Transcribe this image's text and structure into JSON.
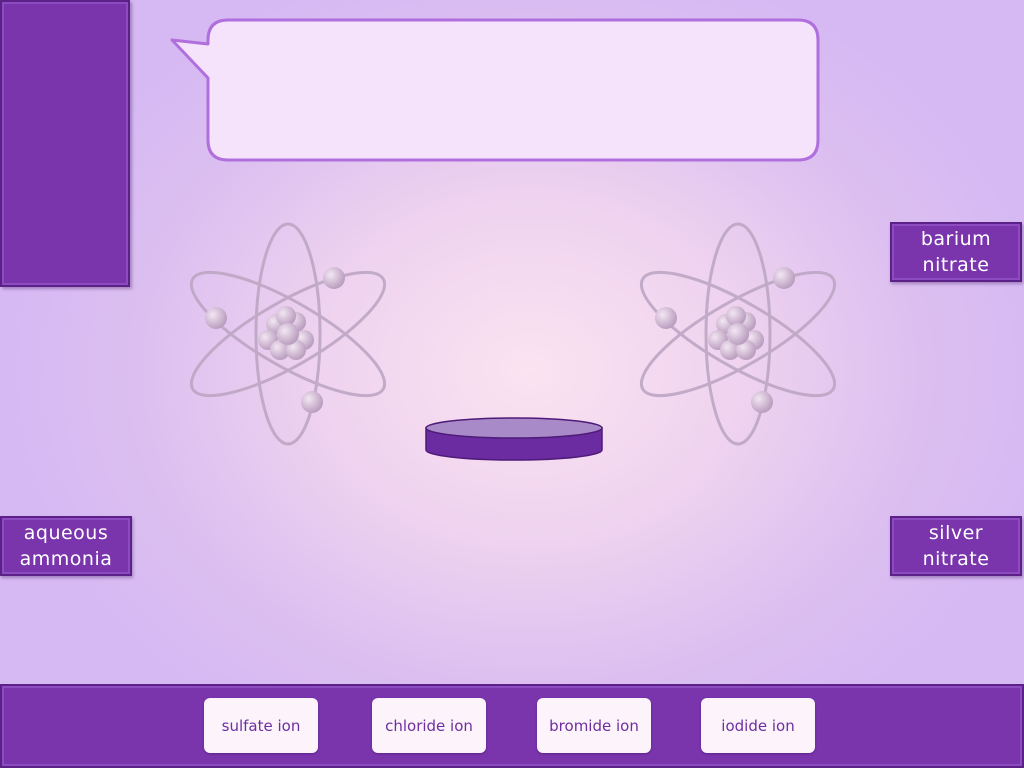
{
  "speech_bubble": {
    "text": ""
  },
  "reagents": {
    "barium_nitrate": {
      "line1": "barium",
      "line2": "nitrate"
    },
    "aqueous_ammonia": {
      "line1": "aqueous",
      "line2": "ammonia"
    },
    "silver_nitrate": {
      "line1": "silver",
      "line2": "nitrate"
    }
  },
  "ions": [
    {
      "label": "sulfate ion"
    },
    {
      "label": "chloride ion"
    },
    {
      "label": "bromide ion"
    },
    {
      "label": "iodide ion"
    }
  ],
  "colors": {
    "accent": "#7a35ad",
    "accent_dark": "#5b2188",
    "bubble_fill": "#f4e3fb",
    "bubble_border": "#b06fdc",
    "button_text": "#6d2fa0"
  },
  "icons": [
    "atom-icon",
    "petri-dish-icon",
    "speech-bubble-icon"
  ]
}
